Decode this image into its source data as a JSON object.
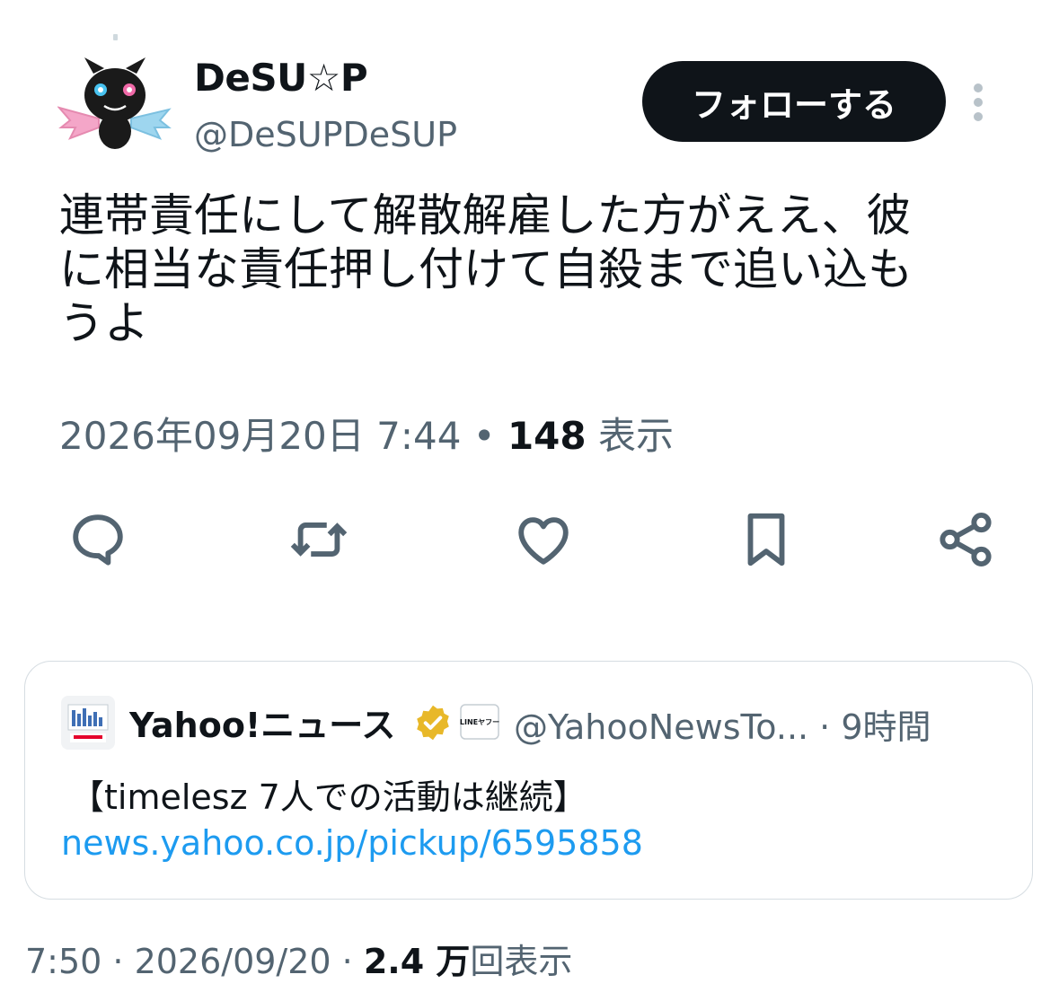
{
  "post": {
    "display_name": "DeSU☆P",
    "handle": "@DeSUPDeSUP",
    "follow_label": "フォローする",
    "text": "連帯責任にして解散解雇した方がええ、彼\nに相当な責任押し付けて自殺まで追い込も\nうよ",
    "timestamp": "2026年09月20日 7:44",
    "separator": " • ",
    "views_count": "148",
    "views_label": " 表示",
    "actions": {
      "reply": "reply-icon",
      "repost": "repost-icon",
      "like": "heart-icon",
      "bookmark": "bookmark-icon",
      "share": "share-icon"
    }
  },
  "quote": {
    "name": "Yahoo!ニュース",
    "badge": "verified-gold-badge",
    "affiliate": "LINEヤフー",
    "handle_time": "@YahooNewsTo... · 9時間",
    "text": "【timelesz 7人での活動は継続】",
    "link": "news.yahoo.co.jp/pickup/6595858"
  },
  "footer": {
    "time_date": "7:50 · 2026/09/20 · ",
    "views_count": "2.4 万",
    "views_label": "回表示"
  },
  "colors": {
    "text": "#0f1419",
    "secondary": "#536471",
    "link": "#1d9bf0",
    "gold": "#e8b829"
  }
}
